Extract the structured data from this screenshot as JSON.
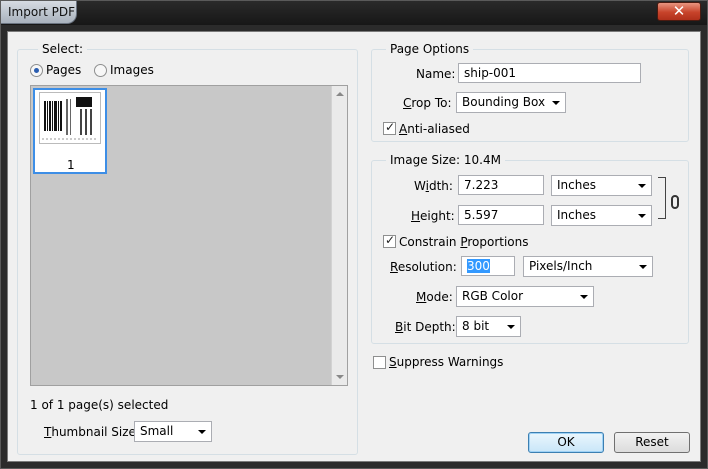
{
  "window": {
    "title": "Import PDF",
    "close_glyph": "✕"
  },
  "select_group": {
    "legend": "Select:",
    "radio_pages": "Pages",
    "radio_images": "Images",
    "selected_radio": "Pages",
    "thumbnails": [
      {
        "page_number": "1",
        "selected": true
      }
    ],
    "status": "1 of 1 page(s) selected",
    "thumbnail_size_label_underlined": "T",
    "thumbnail_size_label_rest": "humbnail Size:",
    "thumbnail_size_value": "Small"
  },
  "page_options": {
    "legend": "Page Options",
    "name_label": "Name:",
    "name_value": "ship-001",
    "crop_label_underlined": "C",
    "crop_label_rest": "rop To:",
    "crop_value": "Bounding Box",
    "anti_aliased_underlined": "A",
    "anti_aliased_rest": "nti-aliased",
    "anti_aliased_checked": true
  },
  "image_size": {
    "legend": "Image Size: 10.4M",
    "width_label_pre": "W",
    "width_label_underlined": "i",
    "width_label_rest": "dth:",
    "width_value": "7.223",
    "width_unit": "Inches",
    "height_label_underlined": "H",
    "height_label_rest": "eight:",
    "height_value": "5.597",
    "height_unit": "Inches",
    "constrain_pre": "Constrain ",
    "constrain_underlined": "P",
    "constrain_rest": "roportions",
    "constrain_checked": true,
    "resolution_label_underlined": "R",
    "resolution_label_rest": "esolution:",
    "resolution_value": "300",
    "resolution_unit": "Pixels/Inch",
    "mode_label_underlined": "M",
    "mode_label_rest": "ode:",
    "mode_value": "RGB Color",
    "bit_depth_label_underlined": "B",
    "bit_depth_label_rest": "it Depth:",
    "bit_depth_value": "8 bit"
  },
  "suppress": {
    "underlined": "S",
    "rest": "uppress Warnings",
    "checked": false
  },
  "buttons": {
    "ok": "OK",
    "reset": "Reset"
  },
  "checkmark_glyph": "✓"
}
